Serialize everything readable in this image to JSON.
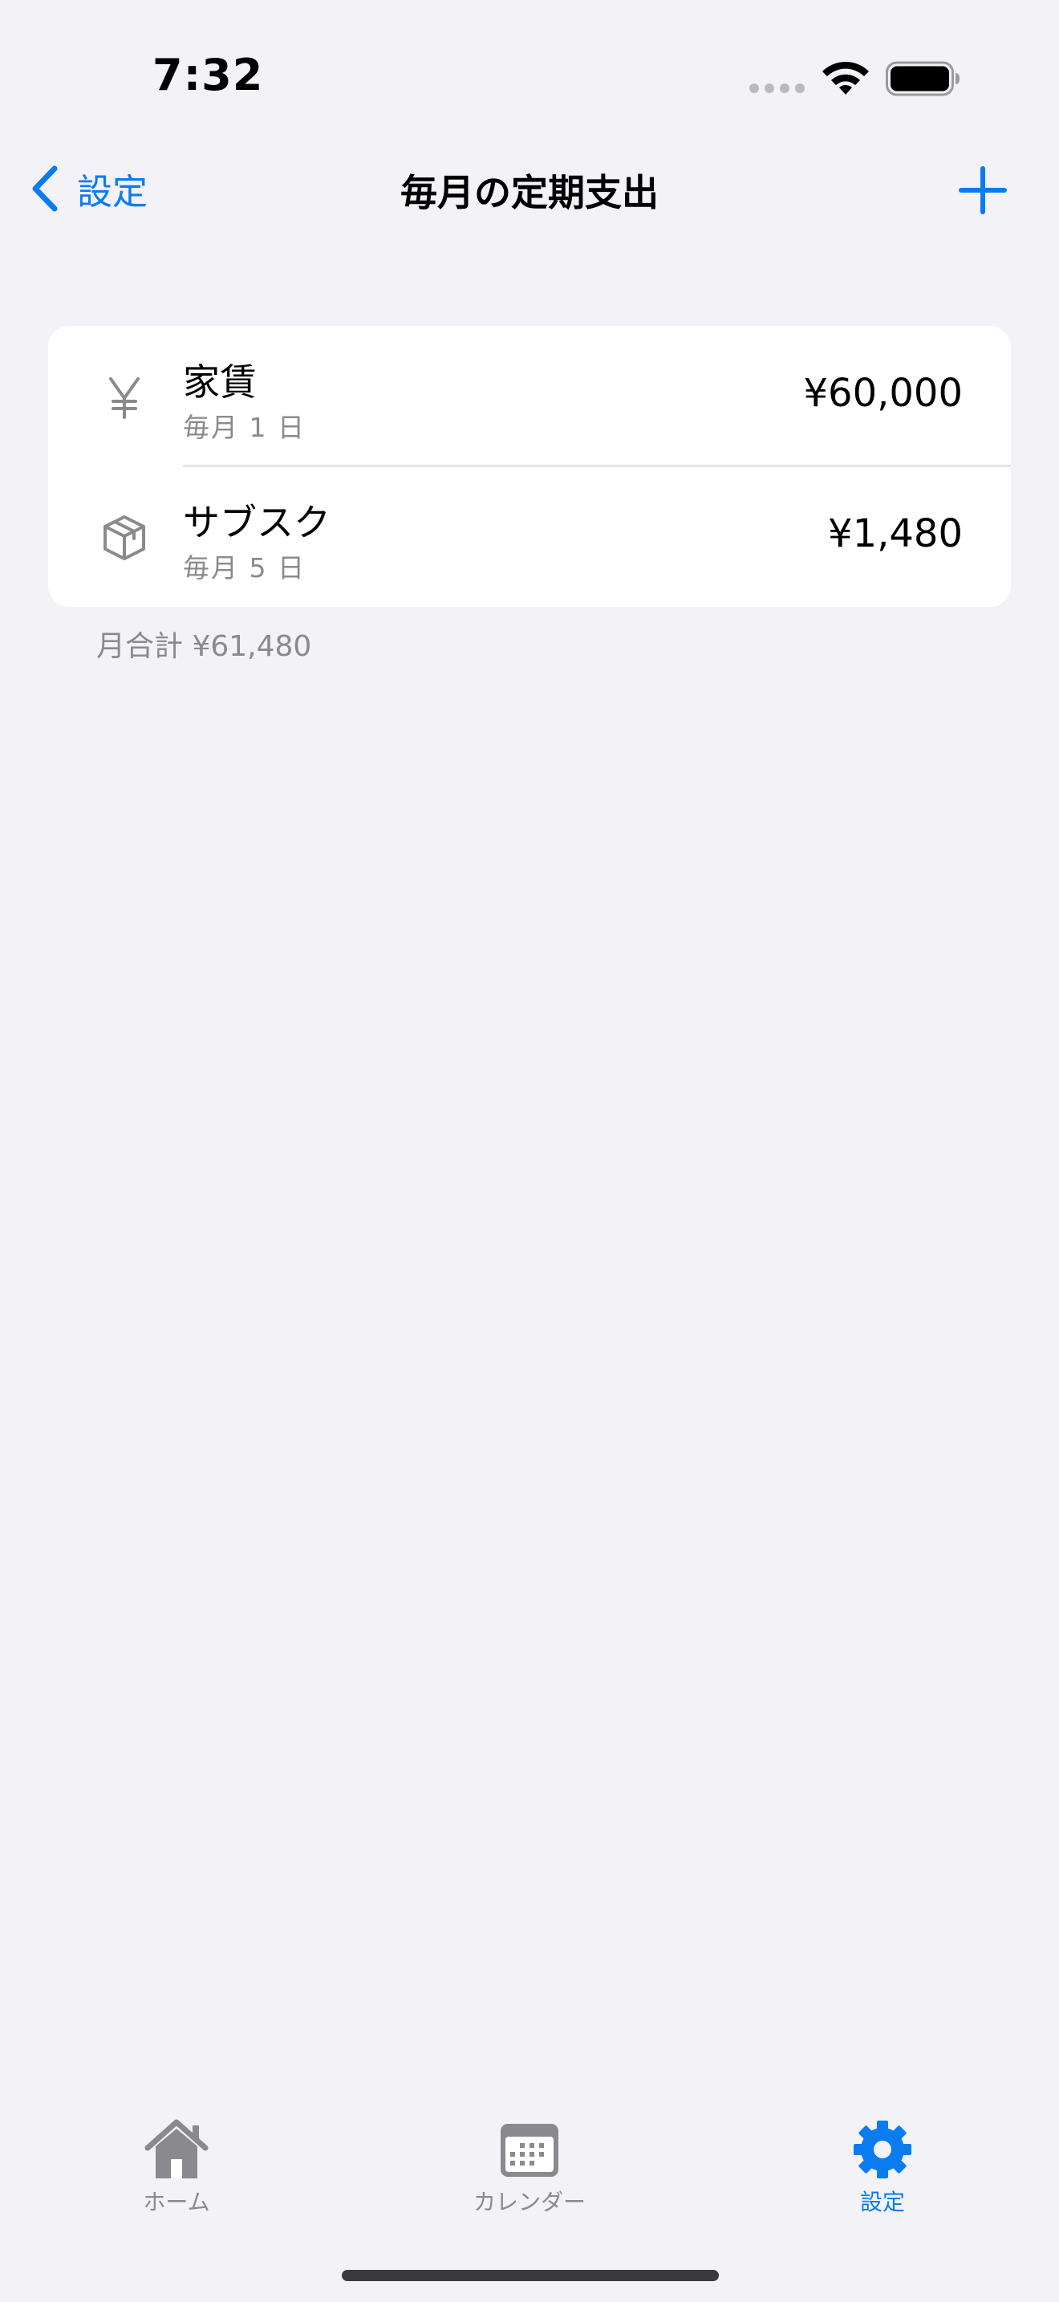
{
  "status_bar": {
    "time": "7:32"
  },
  "nav": {
    "back_label": "設定",
    "title": "毎月の定期支出",
    "add_icon": "plus-icon"
  },
  "expenses": [
    {
      "icon": "yen-icon",
      "title": "家賃",
      "schedule": "毎月 1 日",
      "amount": "¥60,000"
    },
    {
      "icon": "box-icon",
      "title": "サブスク",
      "schedule": "毎月 5 日",
      "amount": "¥1,480"
    }
  ],
  "total": "月合計 ¥61,480",
  "tabs": [
    {
      "icon": "house-icon",
      "label": "ホーム",
      "selected": false
    },
    {
      "icon": "calendar-icon",
      "label": "カレンダー",
      "selected": false
    },
    {
      "icon": "gear-icon",
      "label": "設定",
      "selected": true
    }
  ],
  "colors": {
    "accent": "#0a7cf0",
    "background": "#f2f2f7",
    "secondary_text": "#8a8a8e",
    "inactive_tab": "#8a8a8e"
  }
}
